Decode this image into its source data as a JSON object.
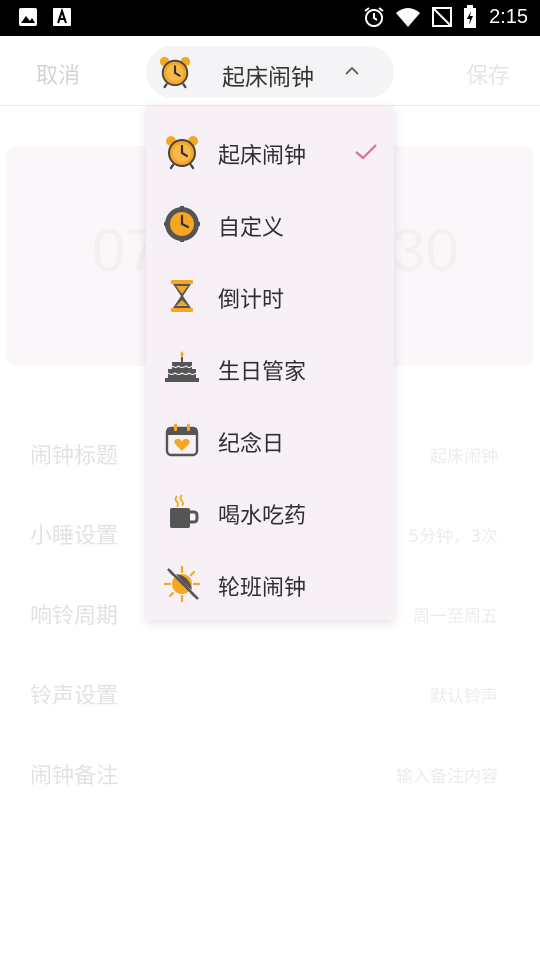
{
  "status_bar": {
    "time": "2:15",
    "left_icons": [
      "gallery-icon",
      "font-icon"
    ],
    "right_icons": [
      "alarm-icon",
      "wifi-icon",
      "no-signal-icon",
      "battery-charging-icon"
    ]
  },
  "header": {
    "cancel_label": "取消",
    "save_label": "保存",
    "selected_type": "起床闹钟",
    "chevron": "chevron-up-icon"
  },
  "background": {
    "time_left": "07",
    "time_right": "30",
    "rows": [
      {
        "label": "闹钟标题",
        "value": "起床闹钟"
      },
      {
        "label": "小睡设置",
        "value": "5分钟，3次"
      },
      {
        "label": "响铃周期",
        "value": "周一至周五"
      },
      {
        "label": "铃声设置",
        "value": "默认铃声"
      },
      {
        "label": "闹钟备注",
        "value": "输入备注内容"
      }
    ]
  },
  "menu": {
    "items": [
      {
        "label": "起床闹钟",
        "icon": "alarm-clock-icon",
        "selected": true
      },
      {
        "label": "自定义",
        "icon": "gear-clock-icon",
        "selected": false
      },
      {
        "label": "倒计时",
        "icon": "hourglass-icon",
        "selected": false
      },
      {
        "label": "生日管家",
        "icon": "birthday-cake-icon",
        "selected": false
      },
      {
        "label": "纪念日",
        "icon": "calendar-heart-icon",
        "selected": false
      },
      {
        "label": "喝水吃药",
        "icon": "mug-icon",
        "selected": false
      },
      {
        "label": "轮班闹钟",
        "icon": "shift-sun-icon",
        "selected": false
      }
    ]
  },
  "colors": {
    "accent_orange": "#F5A623",
    "check_pink": "#E86B8C",
    "menu_bg": "#F7F0F6",
    "dark_icon": "#555555"
  }
}
